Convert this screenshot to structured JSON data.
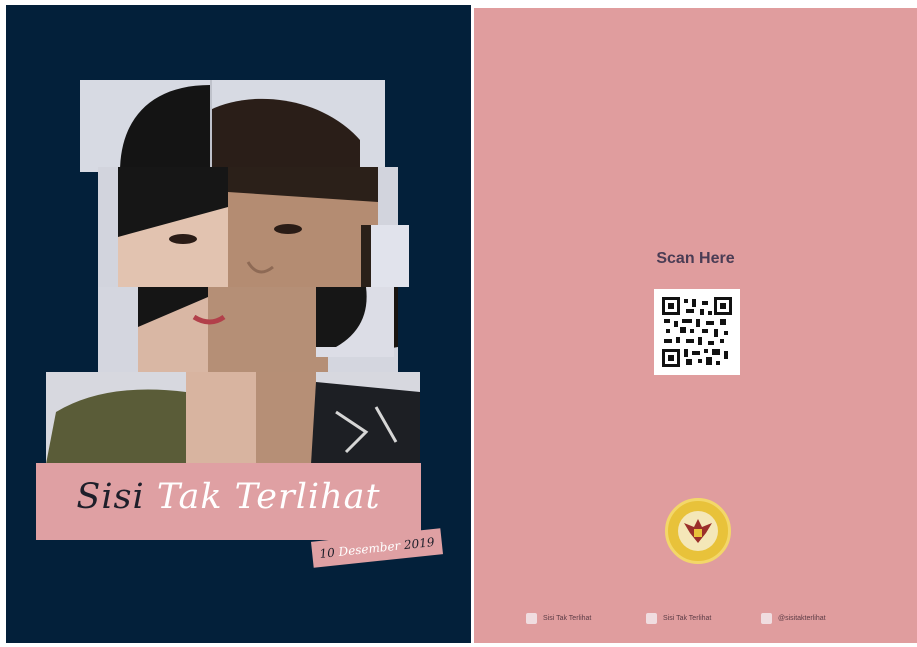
{
  "cover": {
    "title_part1": "Sisi",
    "title_part2": "Tak Terlihat",
    "date_day": "10",
    "date_month": "Desember",
    "date_year": "2019"
  },
  "back": {
    "scan_label": "Scan Here",
    "footer": [
      {
        "icon": "youtube-icon",
        "label": "Sisi Tak Terlihat"
      },
      {
        "icon": "facebook-icon",
        "label": "Sisi Tak Terlihat"
      },
      {
        "icon": "instagram-icon",
        "label": "@sisitakterlihat"
      }
    ]
  },
  "colors": {
    "cover_bg": "#03203a",
    "accent_pink": "#dfa0a3",
    "back_bg": "#e09d9e",
    "emblem_gold": "#e8c23a"
  }
}
